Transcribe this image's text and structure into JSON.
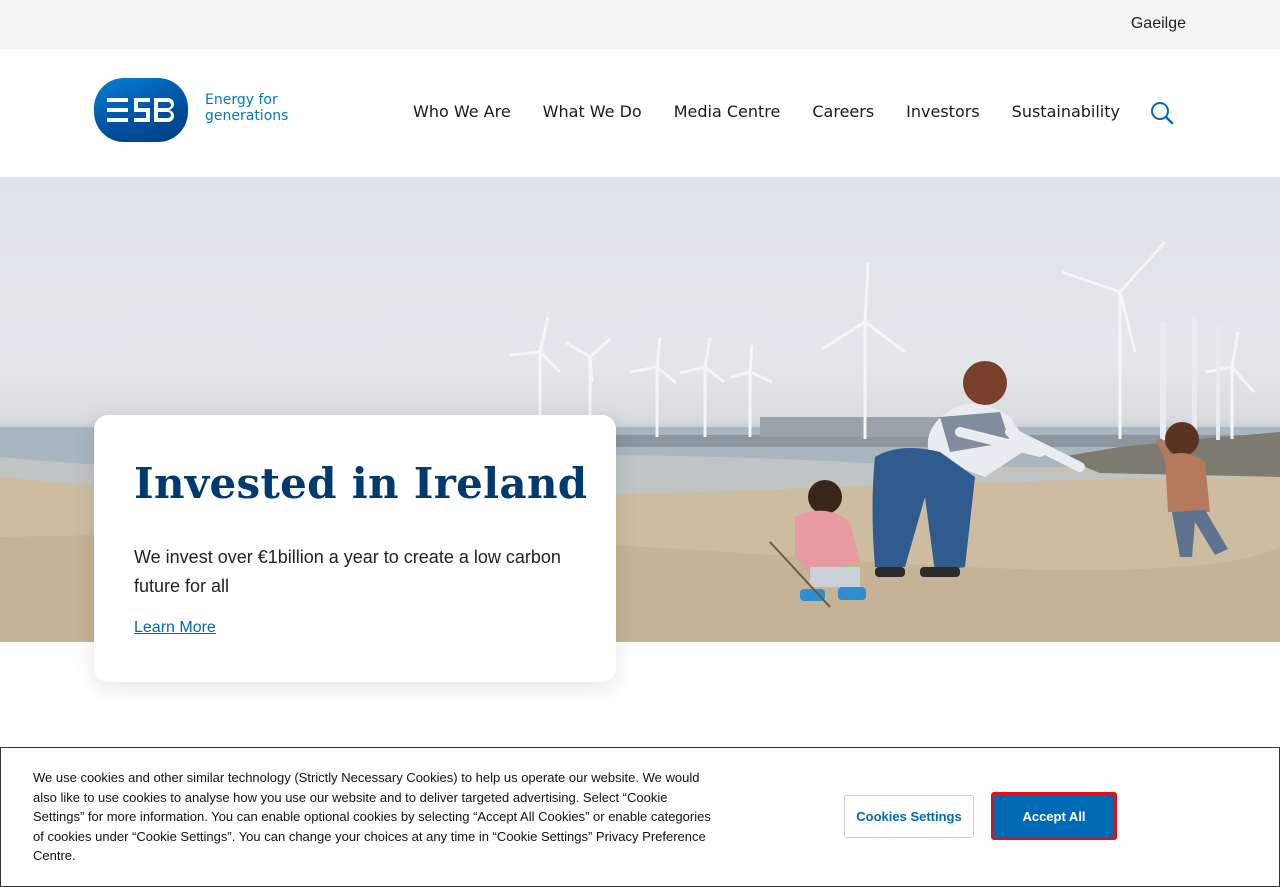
{
  "topbar": {
    "language_link": "Gaeilge"
  },
  "header": {
    "logo": {
      "mark_text": "ESB",
      "tagline_line1": "Energy for",
      "tagline_line2": "generations"
    },
    "nav": [
      "Who We Are",
      "What We Do",
      "Media Centre",
      "Careers",
      "Investors",
      "Sustainability"
    ],
    "search_icon": "search-icon"
  },
  "hero": {
    "title": "Invested in Ireland",
    "description": "We invest over €1billion a year to create a low carbon future for all",
    "cta": "Learn More"
  },
  "cookie_banner": {
    "text": "We use cookies and other similar technology (Strictly Necessary Cookies) to help us operate our website. We would also like to use cookies to analyse how you use our website and to deliver targeted advertising. Select “Cookie Settings” for more information. You can enable optional cookies by selecting “Accept All Cookies” or enable categories of cookies under “Cookie Settings”. You can change your choices at any time in “Cookie Settings” Privacy Preference Centre.",
    "settings_button": "Cookies Settings",
    "accept_button": "Accept All"
  },
  "colors": {
    "brand_blue": "#0069b4",
    "heading_navy": "#003a70",
    "accent_border": "#e0101a"
  }
}
